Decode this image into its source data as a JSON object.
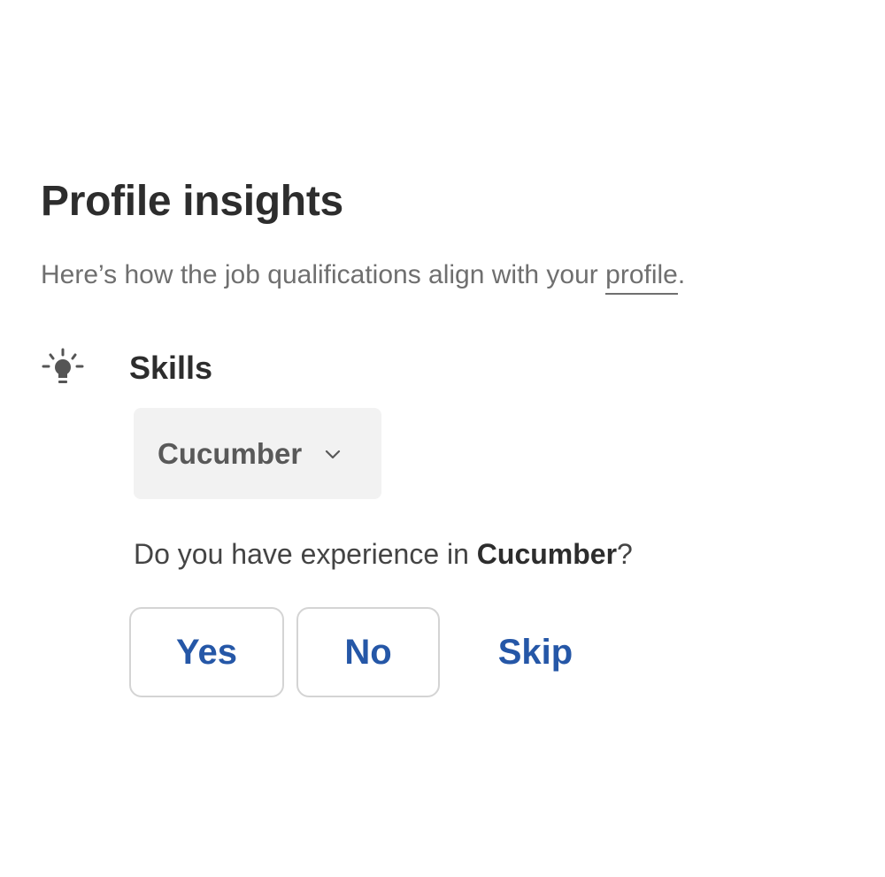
{
  "header": {
    "title": "Profile insights",
    "subtitle_prefix": "Here’s how the job qualifications align with your ",
    "subtitle_link": "profile",
    "subtitle_suffix": "."
  },
  "section": {
    "icon": "lightbulb-icon",
    "label": "Skills"
  },
  "skill_chip": {
    "label": "Cucumber",
    "icon": "chevron-down-icon"
  },
  "question": {
    "prefix": "Do you have experience in ",
    "skill": "Cucumber",
    "suffix": "?"
  },
  "actions": {
    "yes_label": "Yes",
    "no_label": "No",
    "skip_label": "Skip"
  },
  "colors": {
    "accent": "#2557a7",
    "text": "#2d2d2d",
    "muted": "#6f6f6f",
    "chip_bg": "#f2f2f2",
    "button_border": "#d4d4d4"
  }
}
